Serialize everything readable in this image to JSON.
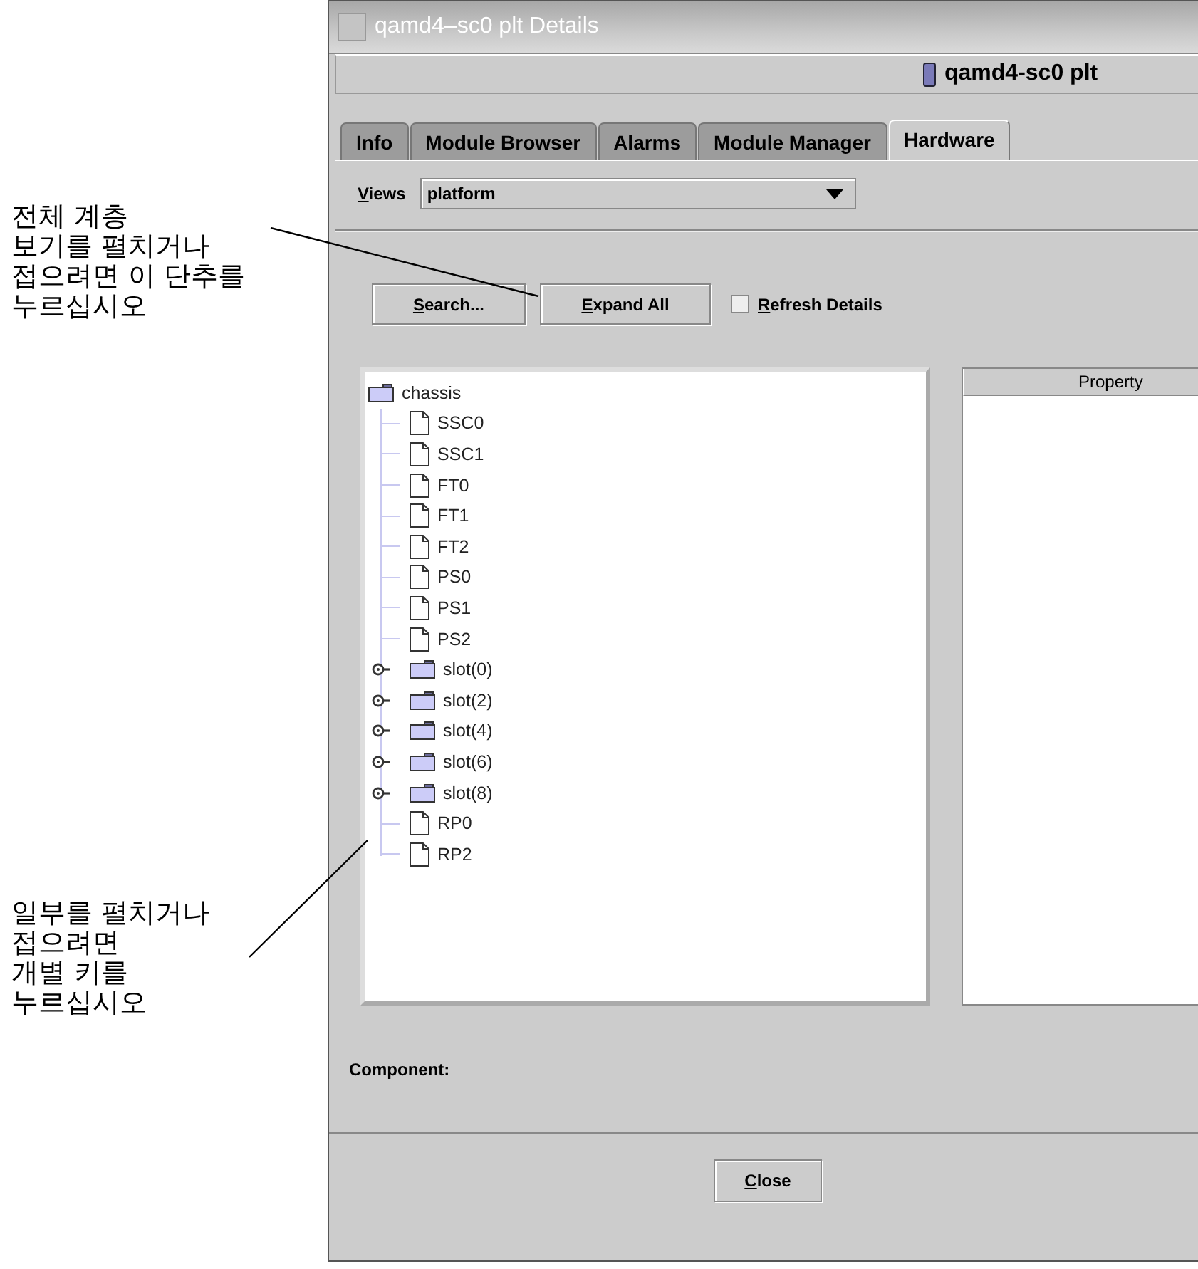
{
  "annotations": [
    {
      "text": "전체 계층\n보기를 펼치거나\n접으려면 이 단추를\n누르십시오"
    },
    {
      "text": "일부를 펼치거나\n접으려면\n개별 키를\n누르십시오"
    }
  ],
  "window": {
    "title": "qamd4–sc0 plt Details",
    "header": "qamd4-sc0 plt"
  },
  "tabs": [
    {
      "label": "Info",
      "selected": false
    },
    {
      "label": "Module Browser",
      "selected": false
    },
    {
      "label": "Alarms",
      "selected": false
    },
    {
      "label": "Module Manager",
      "selected": false
    },
    {
      "label": "Hardware",
      "selected": true
    }
  ],
  "views": {
    "label": "Views",
    "value": "platform"
  },
  "buttons": [
    {
      "label": "Search..."
    },
    {
      "label": "Expand All"
    }
  ],
  "refresh": {
    "label": "Refresh Details",
    "checked": false
  },
  "tree": {
    "label": "chassis",
    "kind": "folder",
    "expanded": true,
    "children": [
      {
        "label": "SSC0",
        "kind": "leaf"
      },
      {
        "label": "SSC1",
        "kind": "leaf"
      },
      {
        "label": "FT0",
        "kind": "leaf"
      },
      {
        "label": "FT1",
        "kind": "leaf"
      },
      {
        "label": "FT2",
        "kind": "leaf"
      },
      {
        "label": "PS0",
        "kind": "leaf"
      },
      {
        "label": "PS1",
        "kind": "leaf"
      },
      {
        "label": "PS2",
        "kind": "leaf"
      },
      {
        "label": "slot(0)",
        "kind": "folder",
        "expanded": false
      },
      {
        "label": "slot(2)",
        "kind": "folder",
        "expanded": false
      },
      {
        "label": "slot(4)",
        "kind": "folder",
        "expanded": false
      },
      {
        "label": "slot(6)",
        "kind": "folder",
        "expanded": false
      },
      {
        "label": "slot(8)",
        "kind": "folder",
        "expanded": false
      },
      {
        "label": "RP0",
        "kind": "leaf"
      },
      {
        "label": "RP2",
        "kind": "leaf"
      }
    ]
  },
  "property_table": {
    "columns": [
      "Property"
    ]
  },
  "component": {
    "label": "Component:"
  },
  "close_button": {
    "label": "Close"
  }
}
